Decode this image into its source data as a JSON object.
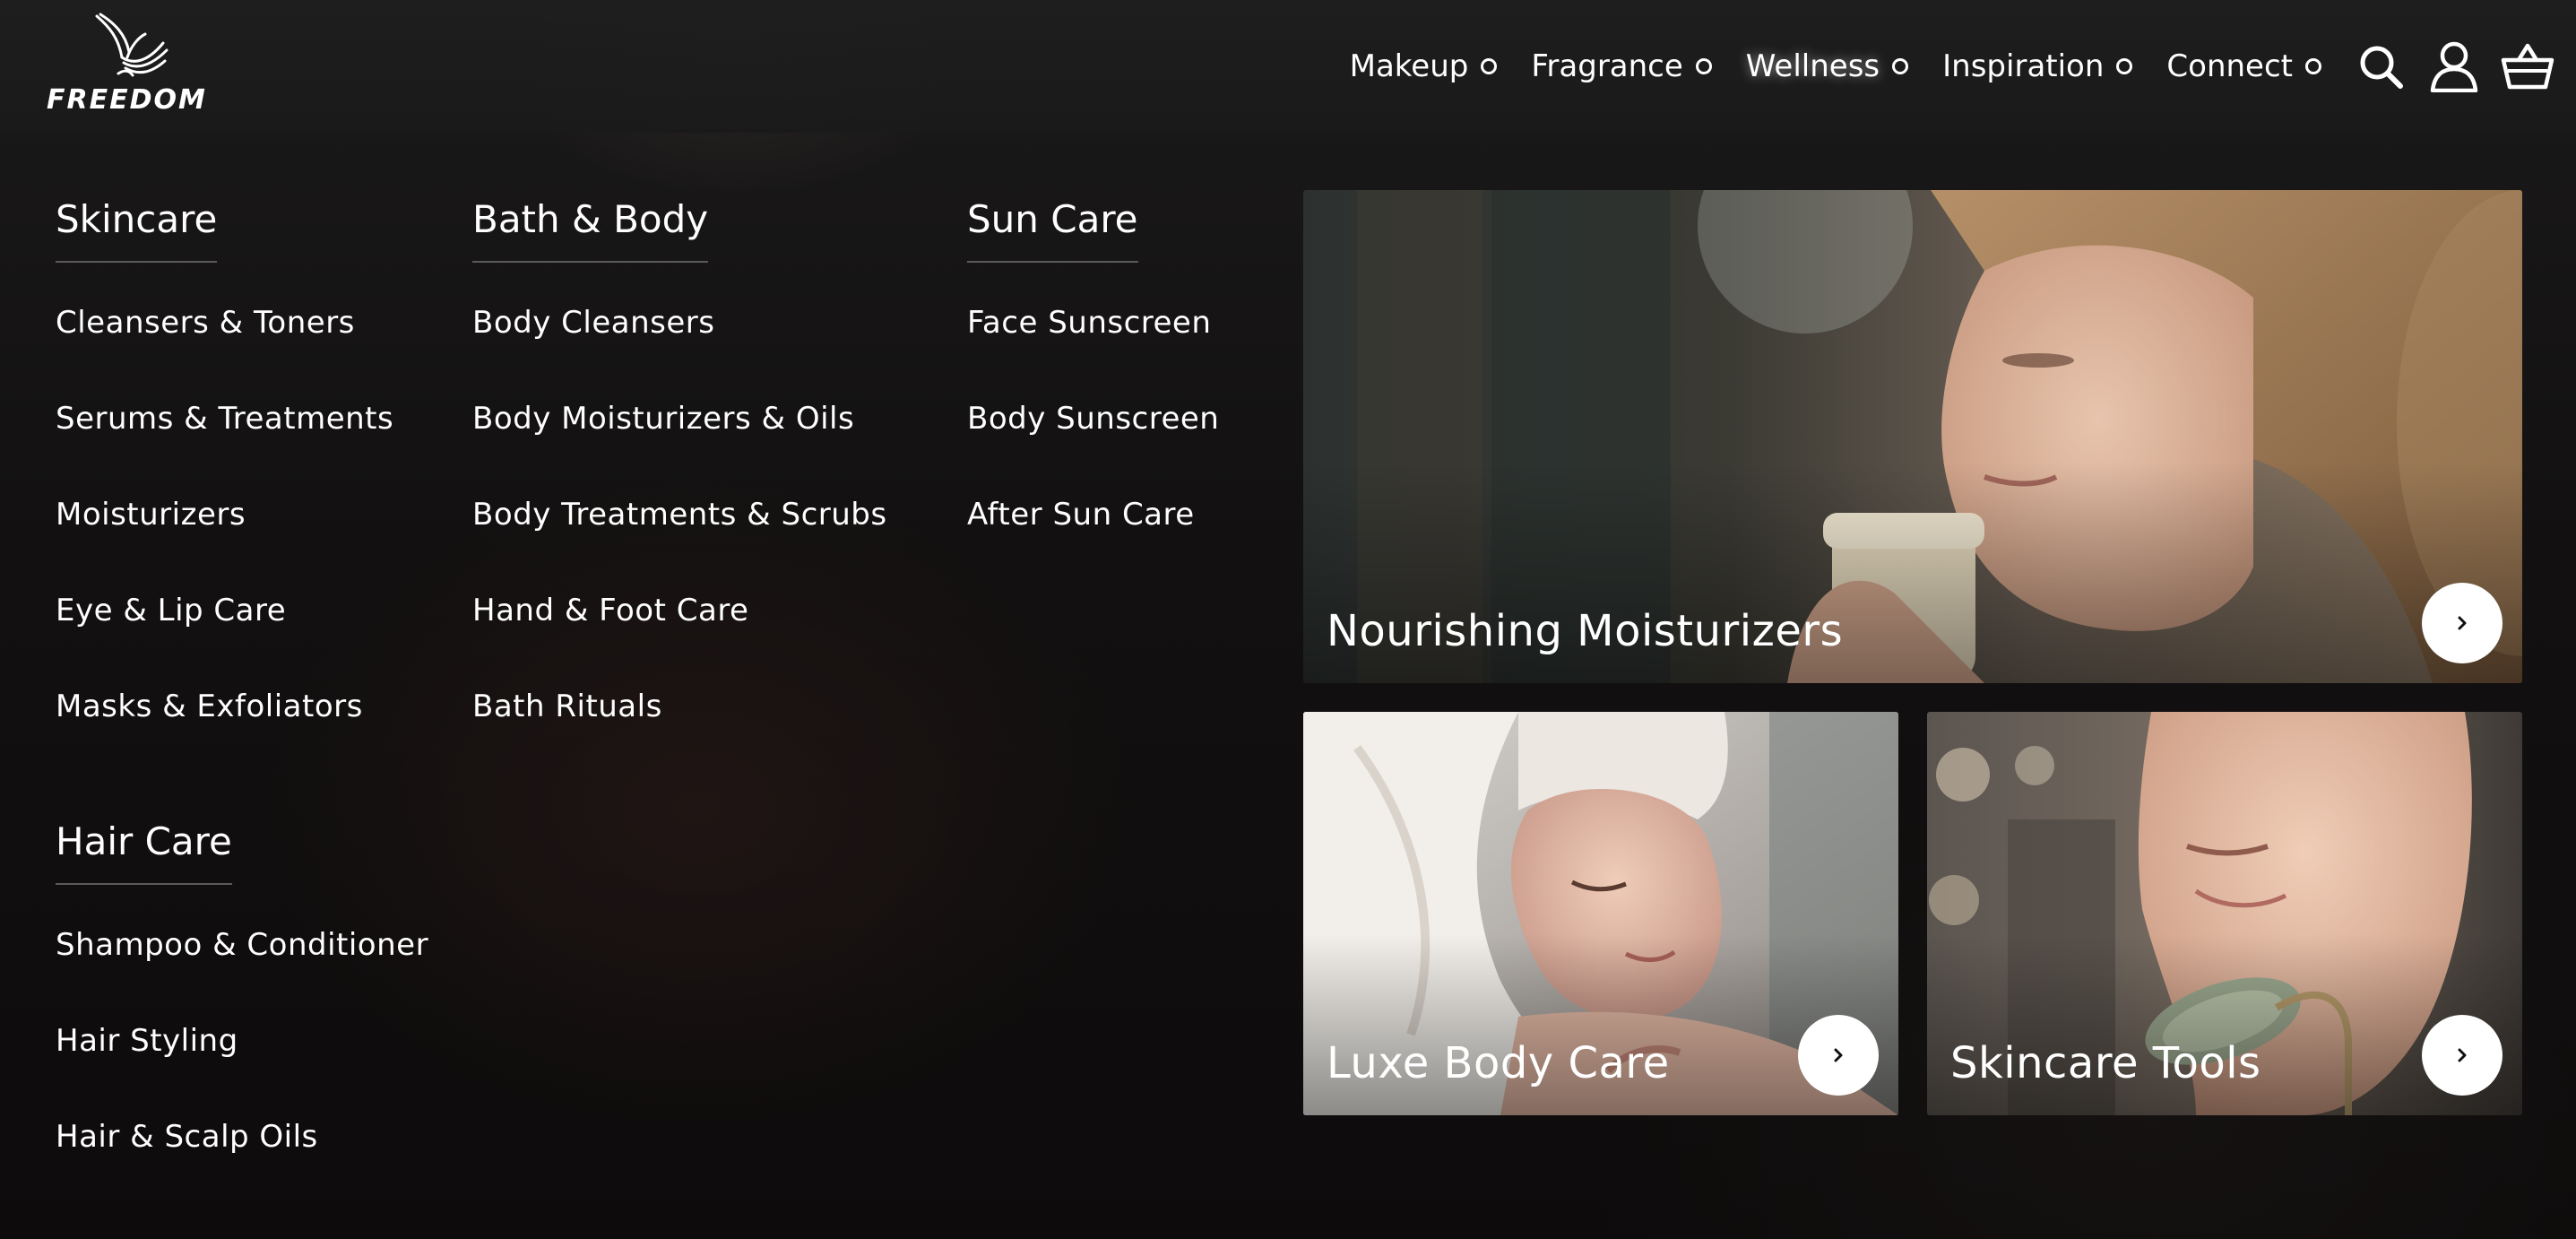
{
  "brand": {
    "name": "FREEDOM"
  },
  "nav": {
    "items": [
      {
        "label": "Makeup",
        "active": false
      },
      {
        "label": "Fragrance",
        "active": false
      },
      {
        "label": "Wellness",
        "active": true
      },
      {
        "label": "Inspiration",
        "active": false
      },
      {
        "label": "Connect",
        "active": false
      }
    ],
    "icons": [
      "search-icon",
      "account-icon",
      "basket-icon"
    ]
  },
  "menu": {
    "skincare": {
      "heading": "Skincare",
      "links": [
        "Cleansers & Toners",
        "Serums & Treatments",
        "Moisturizers",
        "Eye & Lip Care",
        "Masks & Exfoliators"
      ]
    },
    "haircare": {
      "heading": "Hair Care",
      "links": [
        "Shampoo & Conditioner",
        "Hair Styling",
        "Hair & Scalp Oils"
      ]
    },
    "bathbody": {
      "heading": "Bath & Body",
      "links": [
        "Body Cleansers",
        "Body Moisturizers & Oils",
        "Body Treatments & Scrubs",
        "Hand & Foot Care",
        "Bath Rituals"
      ]
    },
    "suncare": {
      "heading": "Sun Care",
      "links": [
        "Face Sunscreen",
        "Body Sunscreen",
        "After Sun Care"
      ]
    }
  },
  "promos": {
    "main": {
      "title": "Nourishing Moisturizers"
    },
    "left": {
      "title": "Luxe Body Care"
    },
    "right": {
      "title": "Skincare Tools"
    }
  }
}
